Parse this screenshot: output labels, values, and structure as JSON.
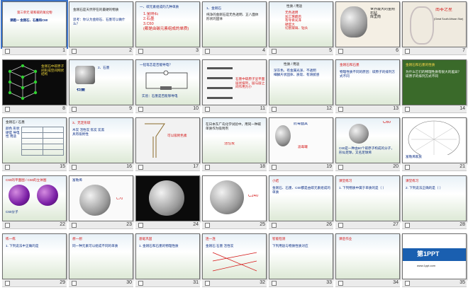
{
  "slides": [
    {
      "num": "1",
      "title": "第三单元 碳和碳的氧化物",
      "text": "课题一 金刚石、石墨和C60"
    },
    {
      "num": "2",
      "title": "金刚石是天然存在的最硬的物质",
      "text": "思考：你认为金刚石、石墨可以做什么？"
    },
    {
      "num": "3",
      "title": "一、碳元素组成的几种单质",
      "text": "1.金刚石\n2.石墨\n3.C60\n(都是由碳元素组成的单质)"
    },
    {
      "num": "4",
      "title": "1、金刚石",
      "text": "纯净的金刚石是无色透明、正八面体形状的固体"
    },
    {
      "num": "5",
      "title": "性质 / 用途",
      "text": "无色透明\n加工琢磨后\n有夺目光泽\n硬度大\n切割玻璃、钻头"
    },
    {
      "num": "6",
      "title": "世界上最大的金刚石",
      "text": "世界最大的金刚石钻\n库里南"
    },
    {
      "num": "7",
      "title": "南非之星",
      "text": "(Great South African Star)"
    },
    {
      "num": "8",
      "title": "金刚石的结构",
      "text": "金刚石中碳原子间形成空间网状结构"
    },
    {
      "num": "9",
      "title": "2、石墨",
      "text": "石墨"
    },
    {
      "num": "10",
      "title": "一铅笔芯是否能导电？",
      "text": "实验：石墨是否能够导电"
    },
    {
      "num": "11",
      "title": "石墨的结构",
      "text": "石墨中碳原子呈平面层状排列，层与层之间作用力小"
    },
    {
      "num": "12",
      "title": "性质 / 用途",
      "text": "深灰色、有金属光泽、不透明\n细鳞片状固体、质软、有滑腻感"
    },
    {
      "num": "13",
      "title": "金刚石和石墨",
      "text": "物理性质不同的原因：碳原子的排列方式不同"
    },
    {
      "num": "14",
      "title": "金刚石和石墨的性质",
      "text": "为什么它们的物理性质有很大的差异？\n碳原子的排列方式不同"
    },
    {
      "num": "15",
      "title": "金刚石 / 石墨",
      "text": "颜色 形状 硬度 导电性 用途"
    },
    {
      "num": "16",
      "title": "3、无定形碳",
      "text": "木炭 活性炭 焦炭 炭黑\n具有吸附性"
    },
    {
      "num": "17",
      "title": "木炭的吸附性",
      "text": "可以吸附色素"
    },
    {
      "num": "18",
      "title": "活性炭",
      "text": "在日本东广岛化学试验中，用同一种碳单质作为吸附剂"
    },
    {
      "num": "19",
      "title": "防毒面具",
      "text": "滤毒罐"
    },
    {
      "num": "20",
      "title": "C60",
      "text": "C60是一种由60个碳原子构成的分子，形似足球，又名足球烯"
    },
    {
      "num": "21",
      "title": "C60的分子结构",
      "text": "富勒烯家族"
    },
    {
      "num": "22",
      "title": "C60的平面图 / C60的立体图",
      "text": "C60分子"
    },
    {
      "num": "23",
      "title": "富勒烯",
      "text": "C70"
    },
    {
      "num": "24",
      "title": "C240",
      "text": ""
    },
    {
      "num": "25",
      "title": "C240",
      "text": "C240"
    },
    {
      "num": "26",
      "title": "小结",
      "text": "金刚石、石墨、C60都是由碳元素组成的单质"
    },
    {
      "num": "27",
      "title": "课堂练习",
      "text": "1. 下列物质中属于单质的是（ ）"
    },
    {
      "num": "28",
      "title": "课堂练习",
      "text": "2. 下列说法正确的是（ ）"
    },
    {
      "num": "29",
      "title": "练一练",
      "text": "1. 下列说法中正确的是"
    },
    {
      "num": "30",
      "title": "想一想",
      "text": "同一种元素可以组成不同的单质"
    },
    {
      "num": "31",
      "title": "基础巩固",
      "text": "1. 金刚石和石墨的物理性质"
    },
    {
      "num": "32",
      "title": "连一连",
      "text": "金刚石 石墨 活性炭"
    },
    {
      "num": "33",
      "title": "智能检测",
      "text": "下列用途与物质性质对应"
    },
    {
      "num": "34",
      "title": "课后作业",
      "text": ""
    },
    {
      "num": "35",
      "title": "第1PPT",
      "text": "www.1ppt.com"
    }
  ]
}
